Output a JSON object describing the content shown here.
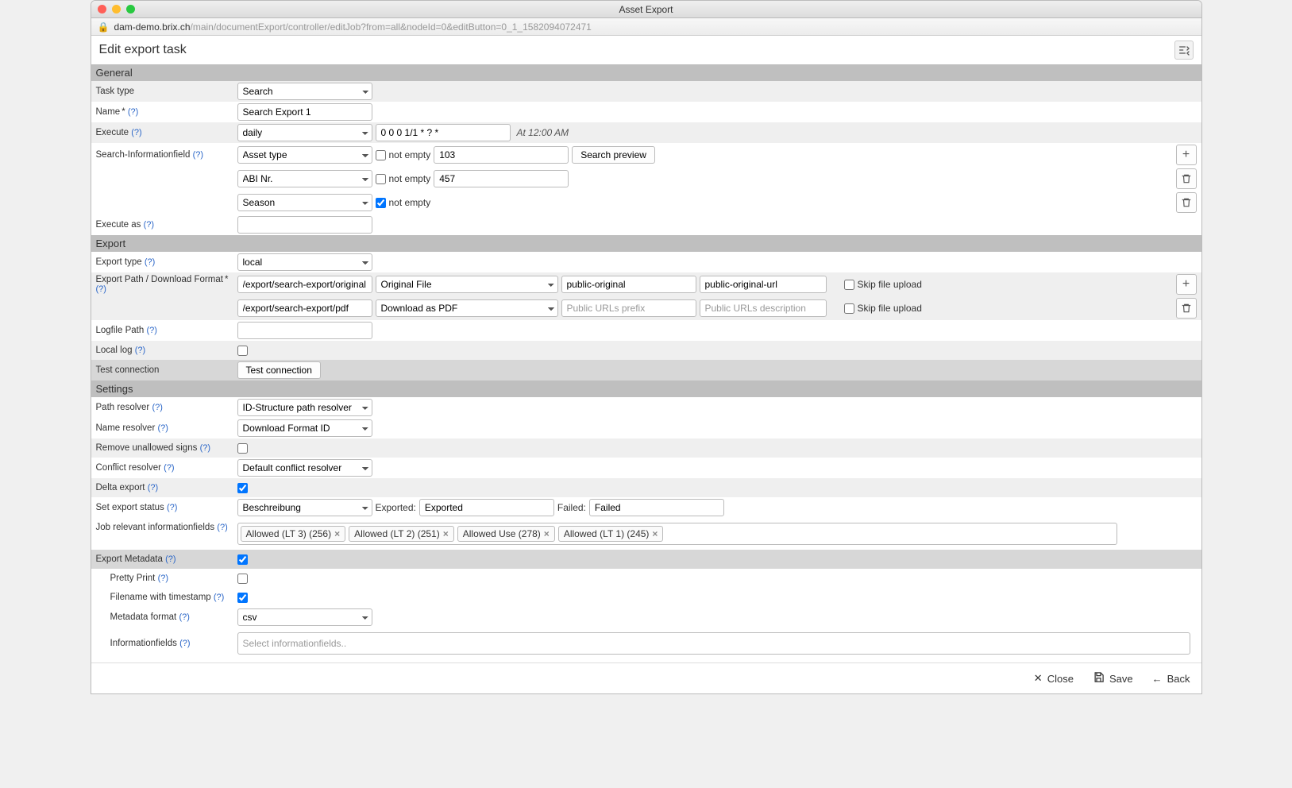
{
  "window": {
    "title": "Asset Export"
  },
  "url": {
    "host": "dam-demo.brix.ch",
    "path": "/main/documentExport/controller/editJob?from=all&nodeId=0&editButton=0_1_1582094072471"
  },
  "page": {
    "title": "Edit export task"
  },
  "sections": {
    "general": "General",
    "export": "Export",
    "settings": "Settings"
  },
  "labels": {
    "task_type": "Task type",
    "name": "Name",
    "execute": "Execute",
    "search_info": "Search-Informationfield",
    "execute_as": "Execute as",
    "export_type": "Export type",
    "export_path": "Export Path / Download Format",
    "logfile_path": "Logfile Path",
    "local_log": "Local log",
    "test_connection": "Test connection",
    "path_resolver": "Path resolver",
    "name_resolver": "Name resolver",
    "remove_unallowed": "Remove unallowed signs",
    "conflict_resolver": "Conflict resolver",
    "delta_export": "Delta export",
    "set_export_status": "Set export status",
    "job_relevant": "Job relevant informationfields",
    "export_metadata": "Export Metadata",
    "pretty_print": "Pretty Print",
    "filename_timestamp": "Filename with timestamp",
    "metadata_format": "Metadata format",
    "informationfields": "Informationfields",
    "not_empty": "not empty",
    "skip_upload": "Skip file upload",
    "exported": "Exported:",
    "failed": "Failed:"
  },
  "general": {
    "task_type": "Search",
    "name": "Search Export 1",
    "execute_freq": "daily",
    "cron": "0 0 0 1/1 * ? *",
    "cron_human": "At 12:00 AM",
    "search_fields": [
      {
        "field": "Asset type",
        "not_empty": false,
        "value": "103"
      },
      {
        "field": "ABI Nr.",
        "not_empty": false,
        "value": "457"
      },
      {
        "field": "Season",
        "not_empty": true,
        "value": ""
      }
    ],
    "execute_as": ""
  },
  "export": {
    "type": "local",
    "paths": [
      {
        "path": "/export/search-export/original",
        "format": "Original File",
        "prefix": "public-original",
        "desc": "public-original-url",
        "skip": false
      },
      {
        "path": "/export/search-export/pdf",
        "format": "Download as PDF",
        "prefix_ph": "Public URLs prefix",
        "desc_ph": "Public URLs description",
        "skip": false
      }
    ],
    "logfile": "",
    "local_log": false,
    "test_btn": "Test connection"
  },
  "settings": {
    "path_resolver": "ID-Structure path resolver",
    "name_resolver": "Download Format ID",
    "remove_unallowed": false,
    "conflict_resolver": "Default conflict resolver",
    "delta_export": true,
    "status_field": "Beschreibung",
    "exported_val": "Exported",
    "failed_val": "Failed",
    "tags": [
      "Allowed (LT 3) (256)",
      "Allowed (LT 2) (251)",
      "Allowed Use (278)",
      "Allowed (LT 1) (245)"
    ],
    "export_metadata": true,
    "pretty_print": false,
    "filename_ts": true,
    "metadata_format": "csv",
    "info_ph": "Select informationfields.."
  },
  "buttons": {
    "search_preview": "Search preview",
    "close": "Close",
    "save": "Save",
    "back": "Back"
  }
}
